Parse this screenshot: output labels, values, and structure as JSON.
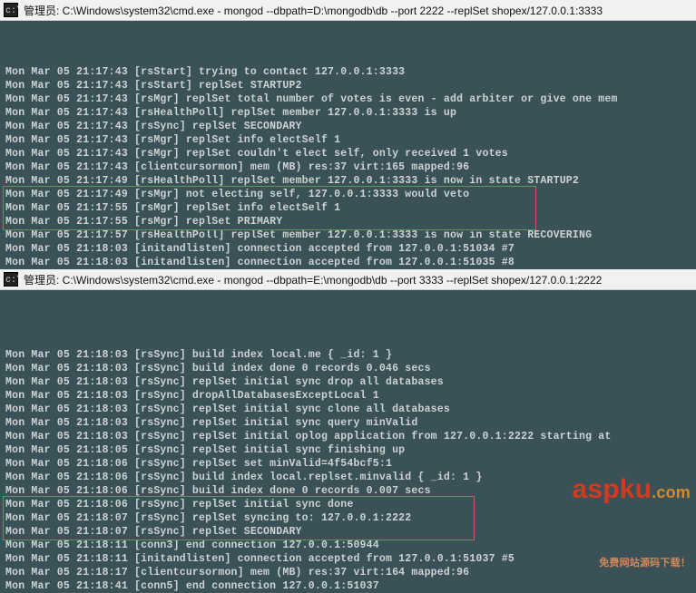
{
  "window1": {
    "title": "管理员: C:\\Windows\\system32\\cmd.exe - mongod  --dbpath=D:\\mongodb\\db --port 2222 --replSet shopex/127.0.0.1:3333",
    "lines": [
      "Mon Mar 05 21:17:43 [rsStart] trying to contact 127.0.0.1:3333",
      "Mon Mar 05 21:17:43 [rsStart] replSet STARTUP2",
      "Mon Mar 05 21:17:43 [rsMgr] replSet total number of votes is even - add arbiter or give one mem",
      "Mon Mar 05 21:17:43 [rsHealthPoll] replSet member 127.0.0.1:3333 is up",
      "Mon Mar 05 21:17:43 [rsSync] replSet SECONDARY",
      "Mon Mar 05 21:17:43 [rsMgr] replSet info electSelf 1",
      "Mon Mar 05 21:17:43 [rsMgr] replSet couldn't elect self, only received 1 votes",
      "Mon Mar 05 21:17:43 [clientcursormon] mem (MB) res:37 virt:165 mapped:96",
      "Mon Mar 05 21:17:49 [rsHealthPoll] replSet member 127.0.0.1:3333 is now in state STARTUP2",
      "Mon Mar 05 21:17:49 [rsMgr] not electing self, 127.0.0.1:3333 would veto",
      "Mon Mar 05 21:17:55 [rsMgr] replSet info electSelf 1",
      "Mon Mar 05 21:17:55 [rsMgr] replSet PRIMARY",
      "Mon Mar 05 21:17:57 [rsHealthPoll] replSet member 127.0.0.1:3333 is now in state RECOVERING",
      "Mon Mar 05 21:18:03 [initandlisten] connection accepted from 127.0.0.1:51034 #7",
      "Mon Mar 05 21:18:03 [initandlisten] connection accepted from 127.0.0.1:51035 #8"
    ]
  },
  "window2": {
    "title": "管理员: C:\\Windows\\system32\\cmd.exe - mongod  --dbpath=E:\\mongodb\\db --port 3333 --replSet shopex/127.0.0.1:2222",
    "lines": [
      "Mon Mar 05 21:18:03 [rsSync] build index local.me { _id: 1 }",
      "Mon Mar 05 21:18:03 [rsSync] build index done 0 records 0.046 secs",
      "Mon Mar 05 21:18:03 [rsSync] replSet initial sync drop all databases",
      "Mon Mar 05 21:18:03 [rsSync] dropAllDatabasesExceptLocal 1",
      "Mon Mar 05 21:18:03 [rsSync] replSet initial sync clone all databases",
      "Mon Mar 05 21:18:03 [rsSync] replSet initial sync query minValid",
      "Mon Mar 05 21:18:03 [rsSync] replSet initial oplog application from 127.0.0.1:2222 starting at ",
      "Mon Mar 05 21:18:05 [rsSync] replSet initial sync finishing up",
      "Mon Mar 05 21:18:06 [rsSync] replSet set minValid=4f54bcf5:1",
      "Mon Mar 05 21:18:06 [rsSync] build index local.replset.minvalid { _id: 1 }",
      "Mon Mar 05 21:18:06 [rsSync] build index done 0 records 0.007 secs",
      "Mon Mar 05 21:18:06 [rsSync] replSet initial sync done",
      "Mon Mar 05 21:18:07 [rsSync] replSet syncing to: 127.0.0.1:2222",
      "Mon Mar 05 21:18:07 [rsSync] replSet SECONDARY",
      "Mon Mar 05 21:18:11 [conn3] end connection 127.0.0.1:50944",
      "Mon Mar 05 21:18:11 [initandlisten] connection accepted from 127.0.0.1:51037 #5",
      "Mon Mar 05 21:18:17 [clientcursormon] mem (MB) res:37 virt:164 mapped:96",
      "Mon Mar 05 21:18:41 [conn5] end connection 127.0.0.1:51037"
    ]
  },
  "watermark": {
    "brand": "aspku",
    "tld": ".com",
    "tagline": "免费网站源码下载！"
  }
}
